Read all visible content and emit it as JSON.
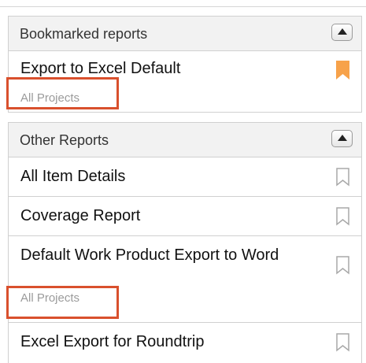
{
  "bookmarked": {
    "title": "Bookmarked reports",
    "reports": [
      {
        "name": "Export to Excel Default",
        "scope": "All Projects",
        "bookmarked": true
      }
    ]
  },
  "other": {
    "title": "Other Reports",
    "reports": [
      {
        "name": "All Item Details",
        "bookmarked": false
      },
      {
        "name": "Coverage Report",
        "bookmarked": false
      },
      {
        "name": "Default Work Product Export to Word",
        "scope": "All Projects",
        "bookmarked": false
      },
      {
        "name": "Excel Export for Roundtrip",
        "bookmarked": false
      }
    ]
  },
  "icons": {
    "collapse": "collapse-up-icon",
    "bookmark_filled": "bookmark-filled-icon",
    "bookmark_outline": "bookmark-outline-icon"
  },
  "colors": {
    "bookmark_active": "#f7a24a",
    "bookmark_inactive": "#a8a8a8",
    "highlight": "#d9502d",
    "header_bg": "#f2f2f2"
  }
}
